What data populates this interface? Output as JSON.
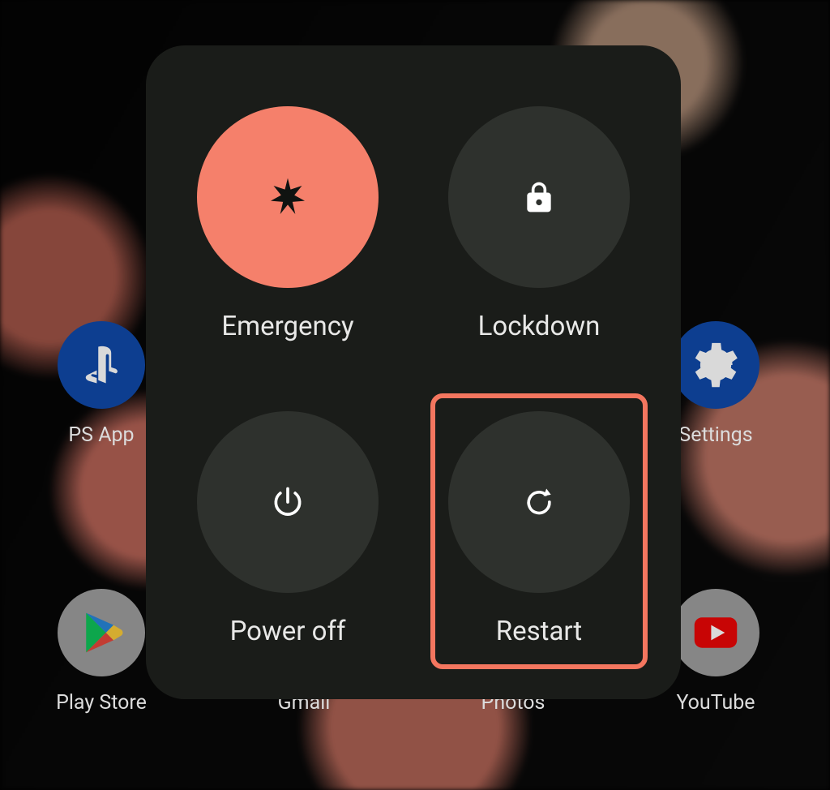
{
  "power_menu": {
    "items": [
      {
        "id": "emergency",
        "label": "Emergency",
        "icon": "asterisk-icon",
        "accent": "#f5806b",
        "highlighted": false
      },
      {
        "id": "lockdown",
        "label": "Lockdown",
        "icon": "lock-icon",
        "accent": "#2e312d",
        "highlighted": false
      },
      {
        "id": "poweroff",
        "label": "Power off",
        "icon": "power-icon",
        "accent": "#2e312d",
        "highlighted": false
      },
      {
        "id": "restart",
        "label": "Restart",
        "icon": "restart-icon",
        "accent": "#2e312d",
        "highlighted": true
      }
    ],
    "highlight_color": "#f4765f"
  },
  "home_icons": {
    "ps": {
      "label": "PS App"
    },
    "settings": {
      "label": "Settings"
    },
    "play": {
      "label": "Play Store"
    },
    "gmail": {
      "label": "Gmail"
    },
    "photos": {
      "label": "Photos"
    },
    "youtube": {
      "label": "YouTube"
    }
  }
}
